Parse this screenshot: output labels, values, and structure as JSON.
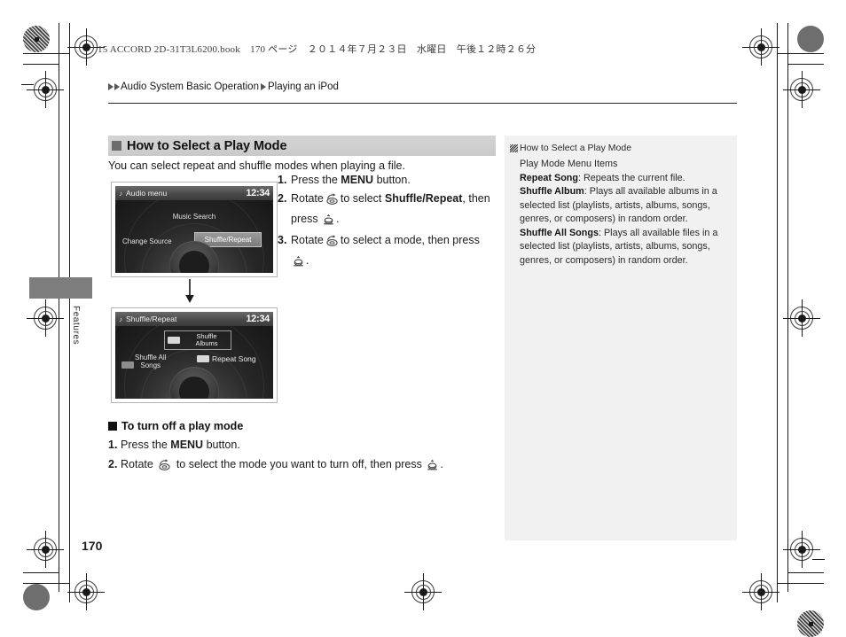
{
  "print_marks": {
    "book_line": "15 ACCORD 2D-31T3L6200.book　170 ページ　２０１４年７月２３日　水曜日　午後１２時２６分"
  },
  "breadcrumb": {
    "parent": "Audio System Basic Operation",
    "child": "Playing an iPod"
  },
  "margin_tab": {
    "label": "Features"
  },
  "section": {
    "title": "How to Select a Play Mode",
    "lede": "You can select repeat and shuffle modes when playing a file.",
    "steps": [
      {
        "num": "1.",
        "pre": "Press the ",
        "bold": "MENU",
        "post": " button."
      },
      {
        "num": "2.",
        "pre": "Rotate ",
        "bold": "",
        "post": ""
      },
      {
        "num": "3.",
        "pre": "Rotate ",
        "bold": "",
        "post": ""
      }
    ],
    "step1_text_pre": "Press the ",
    "step1_bold": "MENU",
    "step1_text_post": " button.",
    "step2_text_pre": "Rotate",
    "step2_text_mid": "to select",
    "step2_bold": "Shuffle/Repeat",
    "step2_text_post": ", then press",
    "step2_tail": ".",
    "step3_text_pre": "Rotate",
    "step3_text_mid": "to select a mode, then press",
    "step3_tail": "."
  },
  "screens": [
    {
      "name": "audio-menu",
      "title": "Audio menu",
      "clock": "12:34",
      "center_label": "Music Search",
      "left_label": "Change Source",
      "selected_label": "Shuffle/Repeat"
    },
    {
      "name": "shuffle-repeat",
      "title": "Shuffle/Repeat",
      "clock": "12:34",
      "top_label_line1": "Shuffle",
      "top_label_line2": "Albums",
      "left_label_line1": "Shuffle All",
      "left_label_line2": "Songs",
      "right_label": "Repeat Song"
    }
  ],
  "subsection": {
    "title": "To turn off a play mode",
    "step1_num": "1.",
    "step1_pre": "Press the ",
    "step1_bold": "MENU",
    "step1_post": " button.",
    "step2_num": "2.",
    "step2_pre": "Rotate",
    "step2_mid": "to select the mode you want to turn off, then press",
    "step2_tail": "."
  },
  "infobox": {
    "heading": "How to Select a Play Mode",
    "subheading": "Play Mode Menu Items",
    "items": [
      {
        "term": "Repeat Song",
        "desc": ": Repeats the current file."
      },
      {
        "term": "Shuffle Album",
        "desc": ": Plays all available albums in a selected list (playlists, artists, albums, songs, genres, or composers) in random order."
      },
      {
        "term": "Shuffle All Songs",
        "desc": ": Plays all available files in a selected list (playlists, artists, albums, songs, genres, or composers) in random order."
      }
    ]
  },
  "folio": {
    "page_number": "170"
  },
  "colors": {
    "section_head_bg": "#cfcfcf",
    "infobox_bg": "#f1f1f1",
    "margin_tab": "#7d7d7d",
    "screen_dark": "#1b1b1b"
  }
}
